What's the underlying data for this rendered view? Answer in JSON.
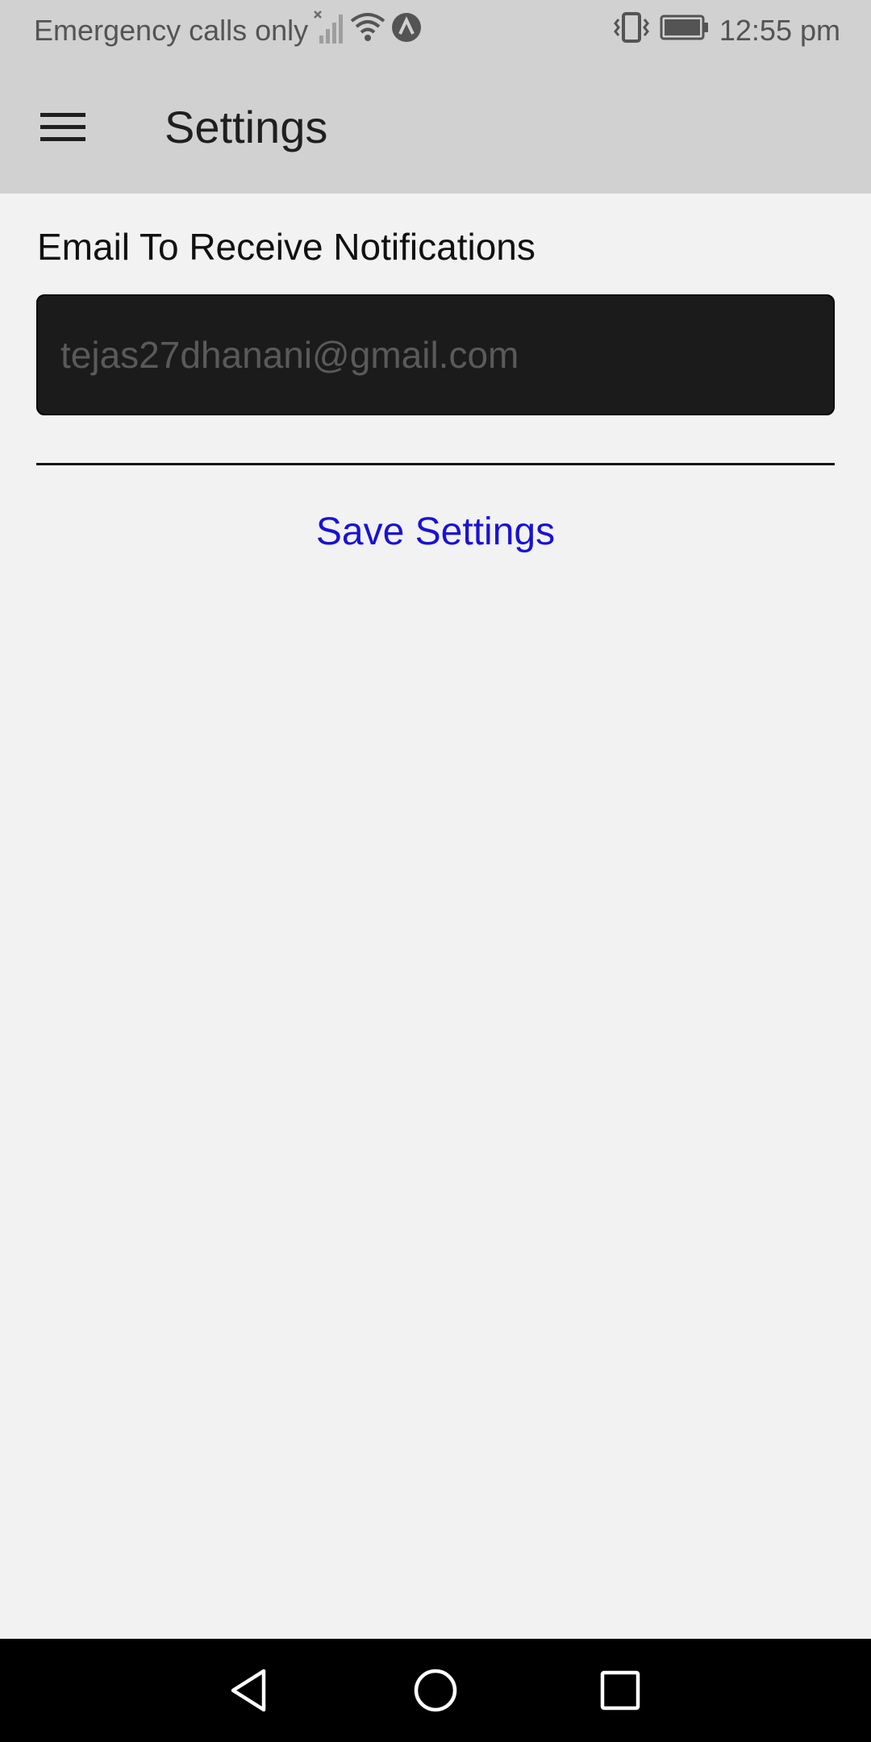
{
  "status_bar": {
    "carrier_text": "Emergency calls only",
    "time": "12:55 pm",
    "icons": [
      "no-signal-icon",
      "wifi-icon",
      "vpn-icon",
      "vibrate-icon",
      "battery-icon"
    ]
  },
  "app_bar": {
    "title": "Settings",
    "menu_icon": "hamburger-menu-icon",
    "background": "#d1d1d1"
  },
  "settings": {
    "email_label": "Email To Receive Notifications",
    "email_value": "",
    "email_placeholder": "tejas27dhanani@gmail.com",
    "save_label": "Save Settings",
    "accent_color": "#1a12d1"
  },
  "nav_bar": {
    "icons": [
      "back-icon",
      "home-icon",
      "recents-icon"
    ]
  }
}
